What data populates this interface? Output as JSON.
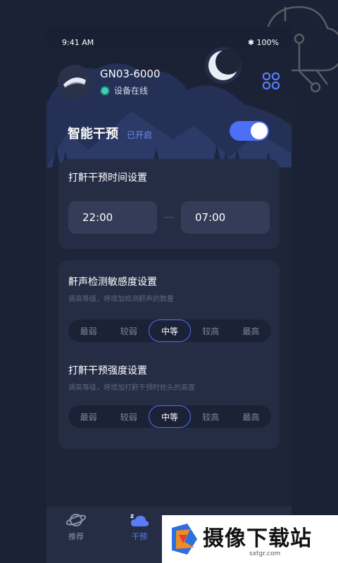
{
  "status_bar": {
    "time": "9:41 AM",
    "battery": "100%"
  },
  "device": {
    "name": "GN03-6000",
    "status": "设备在线"
  },
  "smart": {
    "title": "智能干预",
    "status": "已开启",
    "enabled": true
  },
  "schedule": {
    "title": "打鼾干预时间设置",
    "start": "22:00",
    "end": "07:00"
  },
  "sensitivity": {
    "title": "鼾声检测敏感度设置",
    "subtitle": "调高等级，将增加检测鼾声的数量",
    "options": [
      "最弱",
      "较弱",
      "中等",
      "较高",
      "最高"
    ],
    "selected": "中等"
  },
  "strength": {
    "title": "打鼾干预强度设置",
    "subtitle": "调高等级，将增加打鼾干预时枕头的高度",
    "options": [
      "最弱",
      "较弱",
      "中等",
      "较高",
      "最高"
    ],
    "selected": "中等"
  },
  "tabs": [
    {
      "label": "推荐",
      "icon": "planet-icon",
      "active": false
    },
    {
      "label": "干预",
      "icon": "sleep-cloud-icon",
      "active": true
    }
  ],
  "watermark": {
    "text": "摄像下载站",
    "url": "sxtgr.com"
  },
  "colors": {
    "accent": "#4d6ff6",
    "online": "#3ccfba",
    "card": "#252d45",
    "background": "#1e2538"
  }
}
